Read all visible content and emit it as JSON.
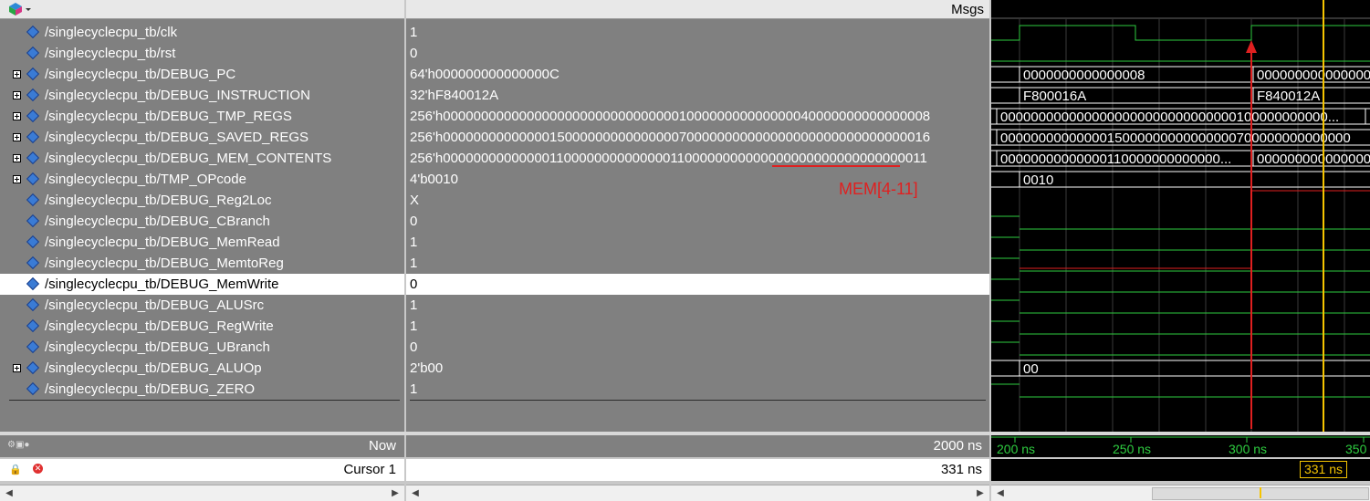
{
  "header": {
    "msgs_label": "Msgs"
  },
  "signals": [
    {
      "name": "/singlecyclecpu_tb/clk",
      "value": "1",
      "expandable": false
    },
    {
      "name": "/singlecyclecpu_tb/rst",
      "value": "0",
      "expandable": false
    },
    {
      "name": "/singlecyclecpu_tb/DEBUG_PC",
      "value": "64'h000000000000000C",
      "expandable": true
    },
    {
      "name": "/singlecyclecpu_tb/DEBUG_INSTRUCTION",
      "value": "32'hF840012A",
      "expandable": true
    },
    {
      "name": "/singlecyclecpu_tb/DEBUG_TMP_REGS",
      "value": "256'h0000000000000000000000000000000100000000000000040000000000000008",
      "expandable": true
    },
    {
      "name": "/singlecyclecpu_tb/DEBUG_SAVED_REGS",
      "value": "256'h0000000000000015000000000000000700000000000000000000000000000016",
      "expandable": true
    },
    {
      "name": "/singlecyclecpu_tb/DEBUG_MEM_CONTENTS",
      "value": "256'h0000000000000011000000000000001100000000000000000000000000000011",
      "expandable": true
    },
    {
      "name": "/singlecyclecpu_tb/TMP_OPcode",
      "value": "4'b0010",
      "expandable": true
    },
    {
      "name": "/singlecyclecpu_tb/DEBUG_Reg2Loc",
      "value": "X",
      "expandable": false
    },
    {
      "name": "/singlecyclecpu_tb/DEBUG_CBranch",
      "value": "0",
      "expandable": false
    },
    {
      "name": "/singlecyclecpu_tb/DEBUG_MemRead",
      "value": "1",
      "expandable": false
    },
    {
      "name": "/singlecyclecpu_tb/DEBUG_MemtoReg",
      "value": "1",
      "expandable": false
    },
    {
      "name": "/singlecyclecpu_tb/DEBUG_MemWrite",
      "value": "0",
      "expandable": false
    },
    {
      "name": "/singlecyclecpu_tb/DEBUG_ALUSrc",
      "value": "1",
      "expandable": false
    },
    {
      "name": "/singlecyclecpu_tb/DEBUG_RegWrite",
      "value": "1",
      "expandable": false
    },
    {
      "name": "/singlecyclecpu_tb/DEBUG_UBranch",
      "value": "0",
      "expandable": false
    },
    {
      "name": "/singlecyclecpu_tb/DEBUG_ALUOp",
      "value": "2'b00",
      "expandable": true
    },
    {
      "name": "/singlecyclecpu_tb/DEBUG_ZERO",
      "value": "1",
      "expandable": false
    }
  ],
  "selected_row": 12,
  "annotation": {
    "label": "MEM[4-11]",
    "color": "#e02020"
  },
  "wave_values": {
    "pc_a": "0000000000000008",
    "pc_b": "000000000000000",
    "instr_a": "F800016A",
    "instr_b": "F840012A",
    "tmp_a": "0000000000000000000000000000000100000000000...",
    "saved_a": "0000000000000015000000000000000700000000000000",
    "mem_a": "00000000000000110000000000000...",
    "mem_b": "000000000000000",
    "opcode_a": "0010",
    "aluop_a": "00"
  },
  "status": {
    "now_label": "Now",
    "now_value": "2000 ns",
    "cursor_label": "Cursor 1",
    "cursor_value": "331 ns"
  },
  "timeline": {
    "ticks": [
      "200 ns",
      "250 ns",
      "300 ns",
      "350"
    ],
    "cursor": "331 ns"
  },
  "colors": {
    "wave_green": "#2ecc40",
    "wave_red": "#e02020",
    "cursor_yellow": "#f5c400",
    "select_blue": "#3a7bd5"
  }
}
